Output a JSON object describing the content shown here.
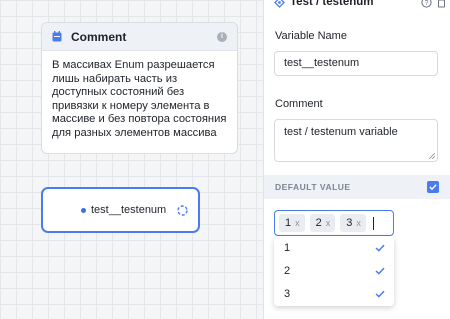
{
  "comment_node": {
    "title": "Comment",
    "text": "В массивах Enum разрешается лишь набирать часть из доступных состояний без привязки к номеру элемента в массиве и без повтора состояния для разных элементов массива"
  },
  "variable_node": {
    "name": "test__testenum"
  },
  "panel": {
    "title": "Test / testenum",
    "variable_name_label": "Variable Name",
    "variable_name_value": "test__testenum",
    "comment_label": "Comment",
    "comment_value": "test / testenum variable",
    "default_value_label": "DEFAULT VALUE",
    "selected_values": [
      {
        "label": "1",
        "remove": "x"
      },
      {
        "label": "2",
        "remove": "x"
      },
      {
        "label": "3",
        "remove": "x"
      }
    ],
    "options": [
      {
        "label": "1",
        "checked": true
      },
      {
        "label": "2",
        "checked": true
      },
      {
        "label": "3",
        "checked": true
      }
    ]
  },
  "colors": {
    "accent": "#4a7cf0",
    "node_border": "#4a7cf0",
    "chip_bg": "#e9ecf0"
  },
  "icons": {
    "comment": "calendar-icon",
    "info": "info-icon",
    "handle": "target-handle-icon",
    "variable": "variable-icon",
    "help": "help-icon",
    "delete": "trash-icon",
    "check": "check-icon"
  }
}
